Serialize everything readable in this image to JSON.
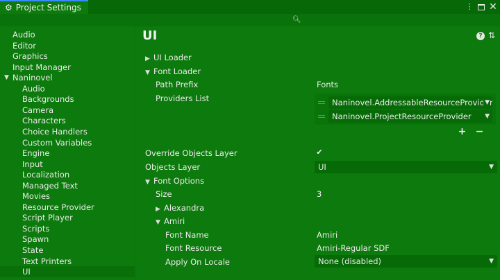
{
  "window": {
    "tab_title": "Project Settings",
    "tab_icon": "gear-icon",
    "controls": [
      "kebab-menu-icon",
      "maximize-icon",
      "close-icon"
    ]
  },
  "search": {
    "placeholder": ""
  },
  "sidebar": {
    "items": [
      {
        "label": "Audio",
        "level": 0
      },
      {
        "label": "Editor",
        "level": 0
      },
      {
        "label": "Graphics",
        "level": 0
      },
      {
        "label": "Input Manager",
        "level": 0
      },
      {
        "label": "Naninovel",
        "level": 0,
        "expanded": true
      },
      {
        "label": "Audio",
        "level": 1
      },
      {
        "label": "Backgrounds",
        "level": 1
      },
      {
        "label": "Camera",
        "level": 1
      },
      {
        "label": "Characters",
        "level": 1
      },
      {
        "label": "Choice Handlers",
        "level": 1
      },
      {
        "label": "Custom Variables",
        "level": 1
      },
      {
        "label": "Engine",
        "level": 1
      },
      {
        "label": "Input",
        "level": 1
      },
      {
        "label": "Localization",
        "level": 1
      },
      {
        "label": "Managed Text",
        "level": 1
      },
      {
        "label": "Movies",
        "level": 1
      },
      {
        "label": "Resource Provider",
        "level": 1
      },
      {
        "label": "Script Player",
        "level": 1
      },
      {
        "label": "Scripts",
        "level": 1
      },
      {
        "label": "Spawn",
        "level": 1
      },
      {
        "label": "State",
        "level": 1
      },
      {
        "label": "Text Printers",
        "level": 1
      },
      {
        "label": "UI",
        "level": 1,
        "selected": true
      }
    ]
  },
  "main": {
    "title": "UI",
    "ui_loader": "UI Loader",
    "font_loader": "Font Loader",
    "path_prefix_label": "Path Prefix",
    "path_prefix_value": "Fonts",
    "providers_list_label": "Providers List",
    "providers": [
      "Naninovel.AddressableResourceProvider",
      "Naninovel.ProjectResourceProvider"
    ],
    "add_button": "+",
    "remove_button": "−",
    "override_objects_layer_label": "Override Objects Layer",
    "override_objects_layer_checked": true,
    "objects_layer_label": "Objects Layer",
    "objects_layer_value": "UI",
    "font_options": "Font Options",
    "size_label": "Size",
    "size_value": "3",
    "alexandra": "Alexandra",
    "amiri": "Amiri",
    "font_name_label": "Font Name",
    "font_name_value": "Amiri",
    "font_resource_label": "Font Resource",
    "font_resource_value": "Amiri-Regular SDF",
    "apply_on_locale_label": "Apply On Locale",
    "apply_on_locale_value": "None (disabled)"
  },
  "colors": {
    "background": "#0c7a0c",
    "tab_accent": "#3a8bff"
  }
}
